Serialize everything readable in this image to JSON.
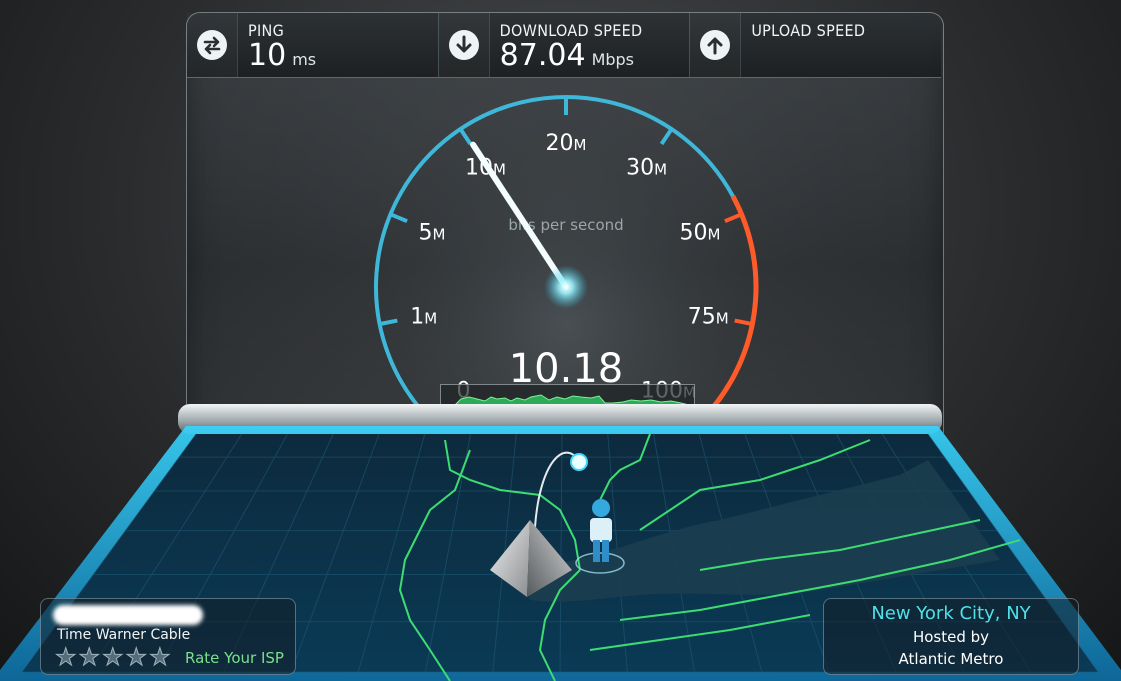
{
  "header": {
    "ping": {
      "label": "PING",
      "value": "10",
      "unit": "ms",
      "icon": "ping-arrows-icon"
    },
    "download": {
      "label": "DOWNLOAD SPEED",
      "value": "87.04",
      "unit": "Mbps",
      "icon": "download-arrow-icon"
    },
    "upload": {
      "label": "UPLOAD SPEED",
      "value": "",
      "unit": "",
      "icon": "upload-arrow-icon"
    }
  },
  "gauge": {
    "caption": "bits per second",
    "current_value": "10.18",
    "needle_value_mbps": 10.18,
    "ticks": [
      {
        "label": "0",
        "unit": ""
      },
      {
        "label": "1",
        "unit": "M"
      },
      {
        "label": "5",
        "unit": "M"
      },
      {
        "label": "10",
        "unit": "M"
      },
      {
        "label": "20",
        "unit": "M"
      },
      {
        "label": "30",
        "unit": "M"
      },
      {
        "label": "50",
        "unit": "M"
      },
      {
        "label": "75",
        "unit": "M"
      },
      {
        "label": "100",
        "unit": "M"
      }
    ],
    "colors": {
      "normal": "#3fb7d9",
      "high": "#ff5a2a",
      "graph": "#3fd06a"
    }
  },
  "isp": {
    "name": "Time Warner Cable",
    "rate_label": "Rate Your ISP",
    "rating": 0,
    "max_rating": 5
  },
  "server": {
    "city": "New York City, NY",
    "hosted_by_label": "Hosted by",
    "host": "Atlantic Metro"
  }
}
